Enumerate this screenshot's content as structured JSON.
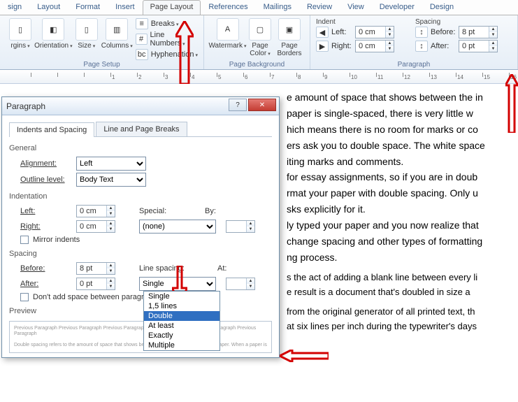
{
  "ribbon_tabs": {
    "t0": "sign",
    "t1": "Layout",
    "t2": "Format",
    "t3": "Insert",
    "t4": "Page Layout",
    "t5": "References",
    "t6": "Mailings",
    "t7": "Review",
    "t8": "View",
    "t9": "Developer",
    "t10": "Design"
  },
  "page_setup": {
    "title": "Page Setup",
    "margins": "rgins",
    "orientation": "Orientation",
    "size": "Size",
    "columns": "Columns",
    "breaks": "Breaks",
    "line_numbers": "Line Numbers",
    "hyphen": "Hyphenation"
  },
  "page_bg": {
    "title": "Page Background",
    "watermark": "Watermark",
    "page_color": "Page\nColor",
    "page_borders": "Page\nBorders"
  },
  "indent": {
    "title": "Indent",
    "left": "Left:",
    "right": "Right:",
    "lval": "0 cm",
    "rval": "0 cm"
  },
  "spacing": {
    "title": "Spacing",
    "before": "Before:",
    "after": "After:",
    "bval": "8 pt",
    "aval": "0 pt"
  },
  "para_group": "Paragraph",
  "doc": {
    "p1": "e amount of space that shows between the in",
    "p2": " paper is single-spaced, there is very little w",
    "p3": "hich means there is no room for marks or co",
    "p4": "ers ask you to double space. The white space",
    "p5": "iting marks and comments.",
    "p6": " for essay assignments, so if you are in doub",
    "p7": "rmat your paper with double spacing. Only u",
    "p8": "sks explicitly for it.",
    "p9": "ly typed your paper and you now realize that",
    "p10": "change spacing and other types of formatting",
    "p11": "ng process.",
    "p12": "s the act of adding a blank line between every li",
    "p13": "e result is a document that's doubled in size a",
    "p14": " from the original generator of all printed text, th",
    "p15": "at six lines per inch during the typewriter's days"
  },
  "dlg": {
    "title": "Paragraph",
    "tab1": "Indents and Spacing",
    "tab2": "Line and Page Breaks",
    "sec_general": "General",
    "alignment": "Alignment:",
    "align_val": "Left",
    "outline": "Outline level:",
    "outline_val": "Body Text",
    "sec_indent": "Indentation",
    "il": "Left:",
    "ir": "Right:",
    "iv": "0 cm",
    "special": "Special:",
    "special_val": "(none)",
    "by": "By:",
    "mirror": "Mirror indents",
    "sec_spacing": "Spacing",
    "before": "Before:",
    "bval": "8 pt",
    "after": "After:",
    "aval": "0 pt",
    "ls": "Line spacing:",
    "ls_val": "Single",
    "at": "At:",
    "dont_add": "Don't add space between paragra",
    "preview": "Preview",
    "opts": {
      "o0": "Single",
      "o1": "1,5 lines",
      "o2": "Double",
      "o3": "At least",
      "o4": "Exactly",
      "o5": "Multiple"
    }
  }
}
